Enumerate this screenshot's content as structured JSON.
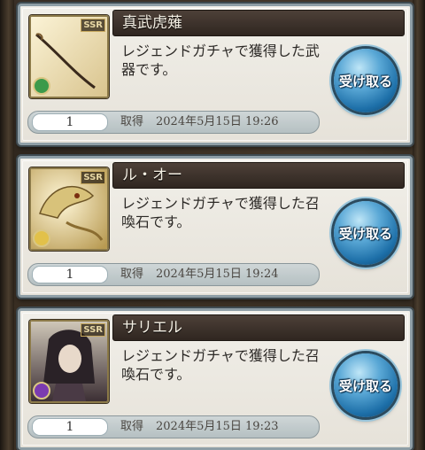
{
  "items": [
    {
      "name": "真武虎薙",
      "description": "レジェンドガチャで獲得した武器です。",
      "quantity": "1",
      "acquired_label": "取得",
      "acquired_at": "2024年5月15日 19:26",
      "rarity": "SSR",
      "element_icon": "wind-element-icon",
      "receive_label": "受け取る"
    },
    {
      "name": "ル・オー",
      "description": "レジェンドガチャで獲得した召喚石です。",
      "quantity": "1",
      "acquired_label": "取得",
      "acquired_at": "2024年5月15日 19:24",
      "rarity": "SSR",
      "element_icon": "light-element-icon",
      "receive_label": "受け取る"
    },
    {
      "name": "サリエル",
      "description": "レジェンドガチャで獲得した召喚石です。",
      "quantity": "1",
      "acquired_label": "取得",
      "acquired_at": "2024年5月15日 19:23",
      "rarity": "SSR",
      "element_icon": "dark-element-icon",
      "receive_label": "受け取る"
    }
  ],
  "colors": {
    "button_blue": "#1d6fa8",
    "title_bar": "#3a2f28",
    "card_bg": "#ebe7df"
  }
}
